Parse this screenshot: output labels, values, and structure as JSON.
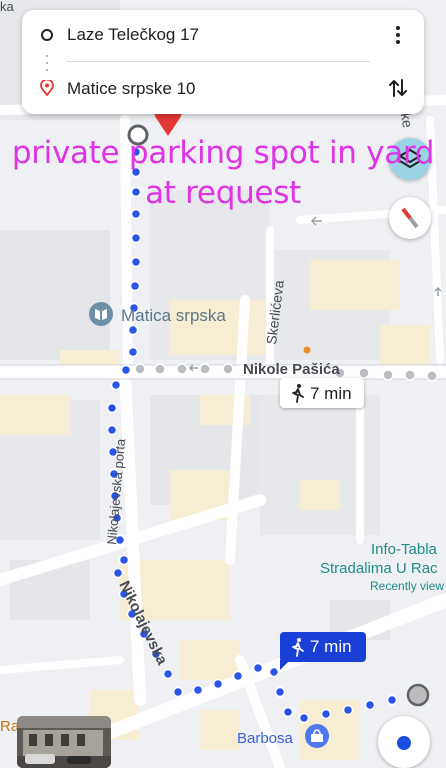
{
  "route": {
    "origin": "Laze Telečkog 17",
    "destination": "Matice srpske 10",
    "menu_icon": "more-vert-icon",
    "swap_icon": "swap-vert-icon"
  },
  "overlay": {
    "line1": "private parking spot in yard",
    "line2": "at request"
  },
  "map_labels": {
    "place_name": "Matica srpska",
    "street_nikole_pasica": "Nikole Pašića",
    "street_skerliceva": "Skerlićeva",
    "street_nikolajevska_porta": "Nikolajevska porta",
    "street_nikolajevska": "Nikolajevska",
    "street_top_partial": "ka",
    "street_right_partial": "tke",
    "poi_info_line1": "Info-Tabla",
    "poi_info_line2": "Stradalima U Rac",
    "poi_info_line3": "Recently view",
    "poi_barbosa": "Barbosa",
    "poi_bottom_left_partial": "Ra"
  },
  "badges": {
    "walk_time_1": "7 min",
    "walk_time_2": "7 min"
  },
  "colors": {
    "route_dots": "#2b55e6",
    "overlay_text": "#e032e6",
    "destination_pin": "#e53935",
    "badge_blue": "#1a3fd6",
    "my_location": "#1a4fe0",
    "place_icon": "#6f8fa6",
    "poi_teal": "#218c87"
  },
  "icons": {
    "origin": "origin-circle-icon",
    "destination": "location-pin-icon",
    "layers": "layers-icon",
    "compass": "compass-icon",
    "my_location": "my-location-icon",
    "walk": "walking-icon",
    "place": "book-place-icon",
    "barbosa": "shopping-bag-icon"
  }
}
